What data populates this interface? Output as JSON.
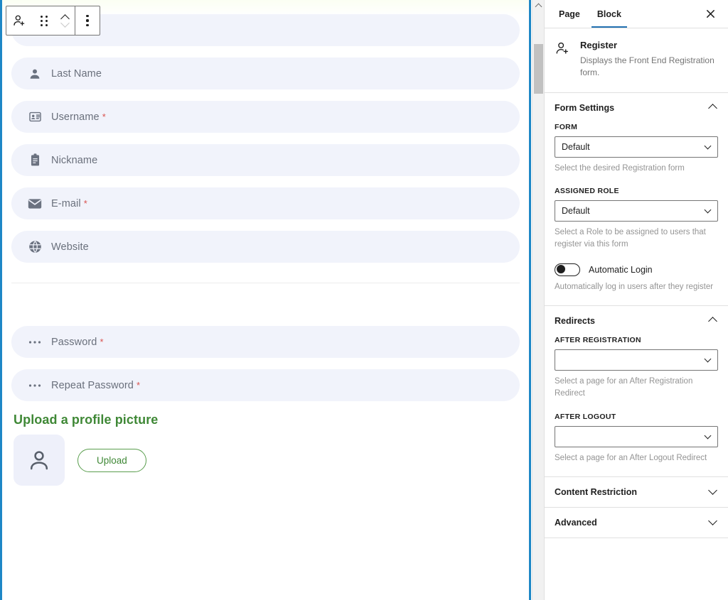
{
  "toolbar": {
    "block_icon": "register-user-add-icon",
    "drag_handle": "drag-handle-icon",
    "move_up": "move-up-icon",
    "move_down": "move-down-icon",
    "options": "more-options-icon"
  },
  "form": {
    "fields": [
      {
        "label": "",
        "icon": "person-icon",
        "required": false,
        "clipped": true
      },
      {
        "label": "Last Name",
        "icon": "person-icon",
        "required": false
      },
      {
        "label": "Username",
        "icon": "id-card-icon",
        "required": true
      },
      {
        "label": "Nickname",
        "icon": "clipboard-icon",
        "required": false
      },
      {
        "label": "E-mail",
        "icon": "envelope-icon",
        "required": true
      },
      {
        "label": "Website",
        "icon": "globe-icon",
        "required": false
      }
    ],
    "password_fields": [
      {
        "label": "Password",
        "icon": "ellipsis-icon",
        "required": true
      },
      {
        "label": "Repeat Password",
        "icon": "ellipsis-icon",
        "required": true
      }
    ],
    "required_marker": "*",
    "profile_picture": {
      "title": "Upload a profile picture",
      "title_color": "#3f8836",
      "upload_label": "Upload",
      "avatar_icon": "avatar-placeholder-icon"
    }
  },
  "sidebar": {
    "tabs": [
      {
        "label": "Page",
        "active": false
      },
      {
        "label": "Block",
        "active": true
      }
    ],
    "close_label": "close-icon",
    "block": {
      "title": "Register",
      "description": "Displays the Front End Registration form.",
      "icon": "register-user-add-icon"
    },
    "panels": [
      {
        "title": "Form Settings",
        "expanded": true,
        "fields": [
          {
            "label": "FORM",
            "type": "select",
            "value": "Default",
            "help": "Select the desired Registration form"
          },
          {
            "label": "ASSIGNED ROLE",
            "type": "select",
            "value": "Default",
            "help": "Select a Role to be assigned to users that register via this form"
          },
          {
            "label": "Automatic Login",
            "type": "toggle",
            "value": false,
            "help": "Automatically log in users after they register"
          }
        ]
      },
      {
        "title": "Redirects",
        "expanded": true,
        "fields": [
          {
            "label": "AFTER REGISTRATION",
            "type": "select",
            "value": "",
            "help": "Select a page for an After Registration Redirect"
          },
          {
            "label": "AFTER LOGOUT",
            "type": "select",
            "value": "",
            "help": "Select a page for an After Logout Redirect"
          }
        ]
      },
      {
        "title": "Content Restriction",
        "expanded": false,
        "fields": []
      },
      {
        "title": "Advanced",
        "expanded": false,
        "fields": []
      }
    ]
  },
  "colors": {
    "accent_blue": "#2271b1",
    "block_outline": "#1e87c6",
    "field_bg": "#f1f3fb",
    "green": "#3f8836",
    "required_red": "#d9534f"
  }
}
